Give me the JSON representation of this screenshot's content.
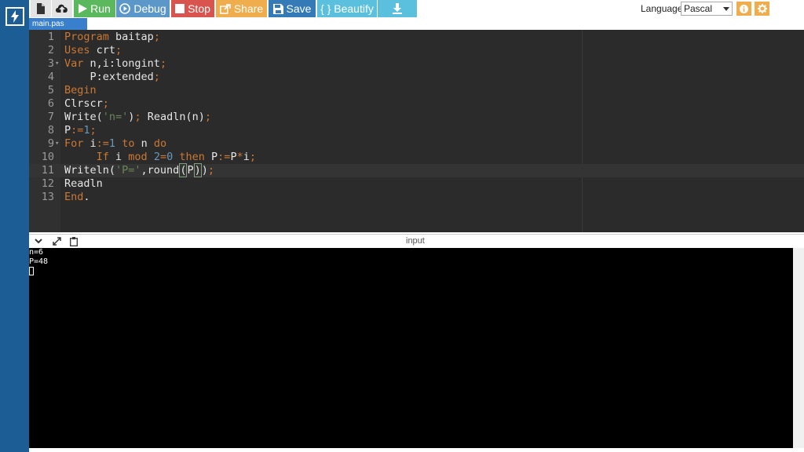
{
  "toolbar": {
    "run_label": "Run",
    "debug_label": "Debug",
    "stop_label": "Stop",
    "share_label": "Share",
    "save_label": "Save",
    "beautify_label": "{ } Beautify"
  },
  "language": {
    "label": "Language",
    "selected": "Pascal"
  },
  "tab": {
    "filename": "main.pas"
  },
  "editor": {
    "lines": [
      {
        "n": "1"
      },
      {
        "n": "2"
      },
      {
        "n": "3"
      },
      {
        "n": "4"
      },
      {
        "n": "5"
      },
      {
        "n": "6"
      },
      {
        "n": "7"
      },
      {
        "n": "8"
      },
      {
        "n": "9"
      },
      {
        "n": "10"
      },
      {
        "n": "11"
      },
      {
        "n": "12"
      },
      {
        "n": "13"
      }
    ],
    "fold_marker": "▾"
  },
  "output": {
    "header_label": "input",
    "lines": [
      "n=6",
      "P=48"
    ]
  },
  "colors": {
    "sidebar": "#1d5d96",
    "run": "#5cb85c",
    "debug": "#5b97c9",
    "stop": "#d9534f",
    "share": "#f0ad4e",
    "save": "#337ab7",
    "beautify": "#5bc0de",
    "editor_bg": "#2b2b2b",
    "keyword": "#cc7832",
    "number": "#6897bb",
    "string": "#6a8759"
  },
  "icons": {
    "logo": "lightning-bolt-icon",
    "file": "file-icon",
    "upload": "cloud-upload-icon",
    "run": "play-icon",
    "debug": "play-circle-icon",
    "stop": "stop-square-icon",
    "share": "share-icon",
    "save": "floppy-disk-icon",
    "download": "download-icon",
    "info": "info-icon",
    "settings": "gear-icon"
  }
}
